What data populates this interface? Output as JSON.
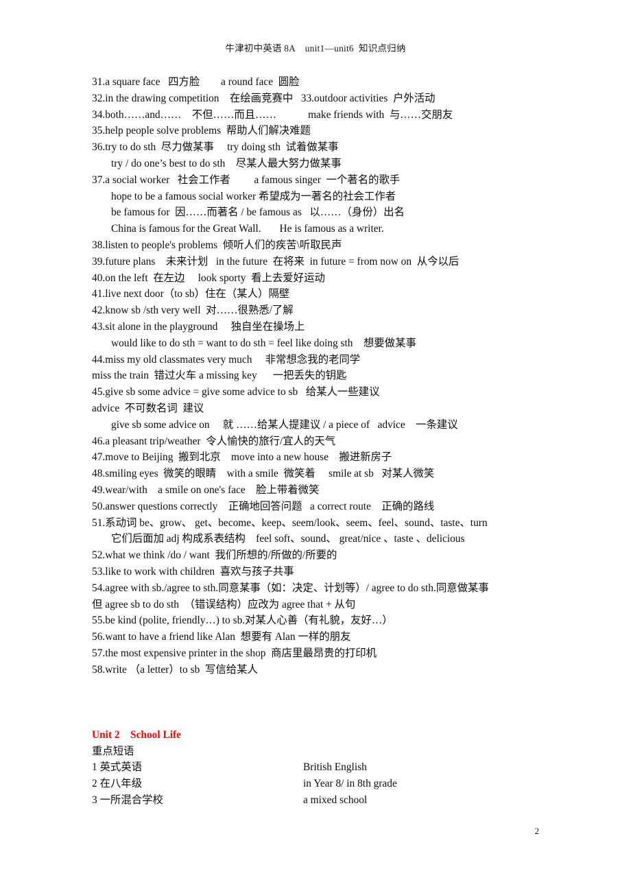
{
  "document": {
    "header": "牛津初中英语 8A    unit1—unit6  知识点归纳",
    "page_number": "2"
  },
  "colors": {
    "text": "#0d0d0d",
    "heading_red": "#FF0000",
    "background": "#FFFFFF"
  },
  "body_lines": [
    {
      "indent": 0,
      "text": "31.a square face   四方脸        a round face  圆脸"
    },
    {
      "indent": 0,
      "text": "32.in the drawing competition    在绘画竞赛中   33.outdoor activities  户外活动"
    },
    {
      "indent": 0,
      "text": "34.both……and……    不但……而且……            make friends with  与……交朋友"
    },
    {
      "indent": 0,
      "text": "35.help people solve problems  帮助人们解决难题"
    },
    {
      "indent": 0,
      "text": "36.try to do sth  尽力做某事     try doing sth  试着做某事"
    },
    {
      "indent": 1,
      "text": "try / do one’s best to do sth    尽某人最大努力做某事"
    },
    {
      "indent": 0,
      "text": "37.a social worker   社会工作者         a famous singer  一个著名的歌手"
    },
    {
      "indent": 1,
      "text": "hope to be a famous social worker 希望成为一著名的社会工作者"
    },
    {
      "indent": 1,
      "text": "be famous for  因……而著名 / be famous as   以……（身份）出名"
    },
    {
      "indent": 1,
      "text": "China is famous for the Great Wall.       He is famous as a writer."
    },
    {
      "indent": 0,
      "text": "38.listen to people's problems  倾听人们的疾苦\\听取民声"
    },
    {
      "indent": 0,
      "text": "39.future plans    未来计划   in the future  在将来  in future = from now on  从今以后"
    },
    {
      "indent": 0,
      "text": "40.on the left  在左边     look sporty  看上去爱好运动"
    },
    {
      "indent": 0,
      "text": "41.live next door（to sb）住在（某人）隔壁"
    },
    {
      "indent": 0,
      "text": "42.know sb /sth very well  对……很熟悉/了解"
    },
    {
      "indent": 0,
      "text": "43.sit alone in the playground     独自坐在操场上"
    },
    {
      "indent": 1,
      "text": "would like to do sth = want to do sth = feel like doing sth    想要做某事"
    },
    {
      "indent": 0,
      "text": "44.miss my old classmates very much     非常想念我的老同学"
    },
    {
      "indent": 0,
      "text": "miss the train  错过火车 a missing key      一把丢失的钥匙"
    },
    {
      "indent": 0,
      "text": "45.give sb some advice = give some advice to sb   给某人一些建议"
    },
    {
      "indent": 0,
      "text": "advice  不可数名词  建议"
    },
    {
      "indent": 1,
      "text": "give sb some advice on     就 ……给某人提建议 / a piece of   advice    一条建议"
    },
    {
      "indent": 0,
      "text": "46.a pleasant trip/weather  令人愉快的旅行/宜人的天气"
    },
    {
      "indent": 0,
      "text": "47.move to Beijing  搬到北京    move into a new house    搬进新房子"
    },
    {
      "indent": 0,
      "text": "48.smiling eyes  微笑的眼睛    with a smile  微笑着     smile at sb   对某人微笑"
    },
    {
      "indent": 0,
      "text": "49.wear/with    a smile on one's face    脸上带着微笑"
    },
    {
      "indent": 0,
      "text": "50.answer questions correctly    正确地回答问题   a correct route    正确的路线"
    },
    {
      "indent": 0,
      "text": "51.系动词 be、grow、 get、become、keep、seem/look、seem、feel、sound、taste、turn"
    },
    {
      "indent": 1,
      "text": "它们后面加 adj 构成系表结构    feel soft、sound、 great/nice 、taste 、delicious"
    },
    {
      "indent": 0,
      "text": "52.what we think /do / want  我们所想的/所做的/所要的"
    },
    {
      "indent": 0,
      "text": "53.like to work with children  喜欢与孩子共事"
    },
    {
      "indent": 0,
      "text": "54.agree with sb./agree to sth.同意某事（如：决定、计划等）/ agree to do sth.同意做某事"
    },
    {
      "indent": 0,
      "text": "但 agree sb to do sth  （错误结构）应改为 agree that + 从句"
    },
    {
      "indent": 0,
      "text": "55.be kind (polite, friendly…) to sb.对某人心善（有礼貌，友好…）"
    },
    {
      "indent": 0,
      "text": "56.want to have a friend like Alan  想要有 Alan 一样的朋友"
    },
    {
      "indent": 0,
      "text": "57.the most expensive printer in the shop  商店里最昂贵的打印机"
    },
    {
      "indent": 0,
      "text": "58.write （a letter）to sb  写信给某人"
    }
  ],
  "unit2": {
    "heading": "Unit 2    School Life",
    "sub_heading": "重点短语",
    "phrases": [
      {
        "cn": "1 英式英语",
        "en": "British English"
      },
      {
        "cn": "2 在八年级",
        "en": "in Year 8/ in 8th grade"
      },
      {
        "cn": "3 一所混合学校",
        "en": "a mixed school"
      }
    ]
  }
}
